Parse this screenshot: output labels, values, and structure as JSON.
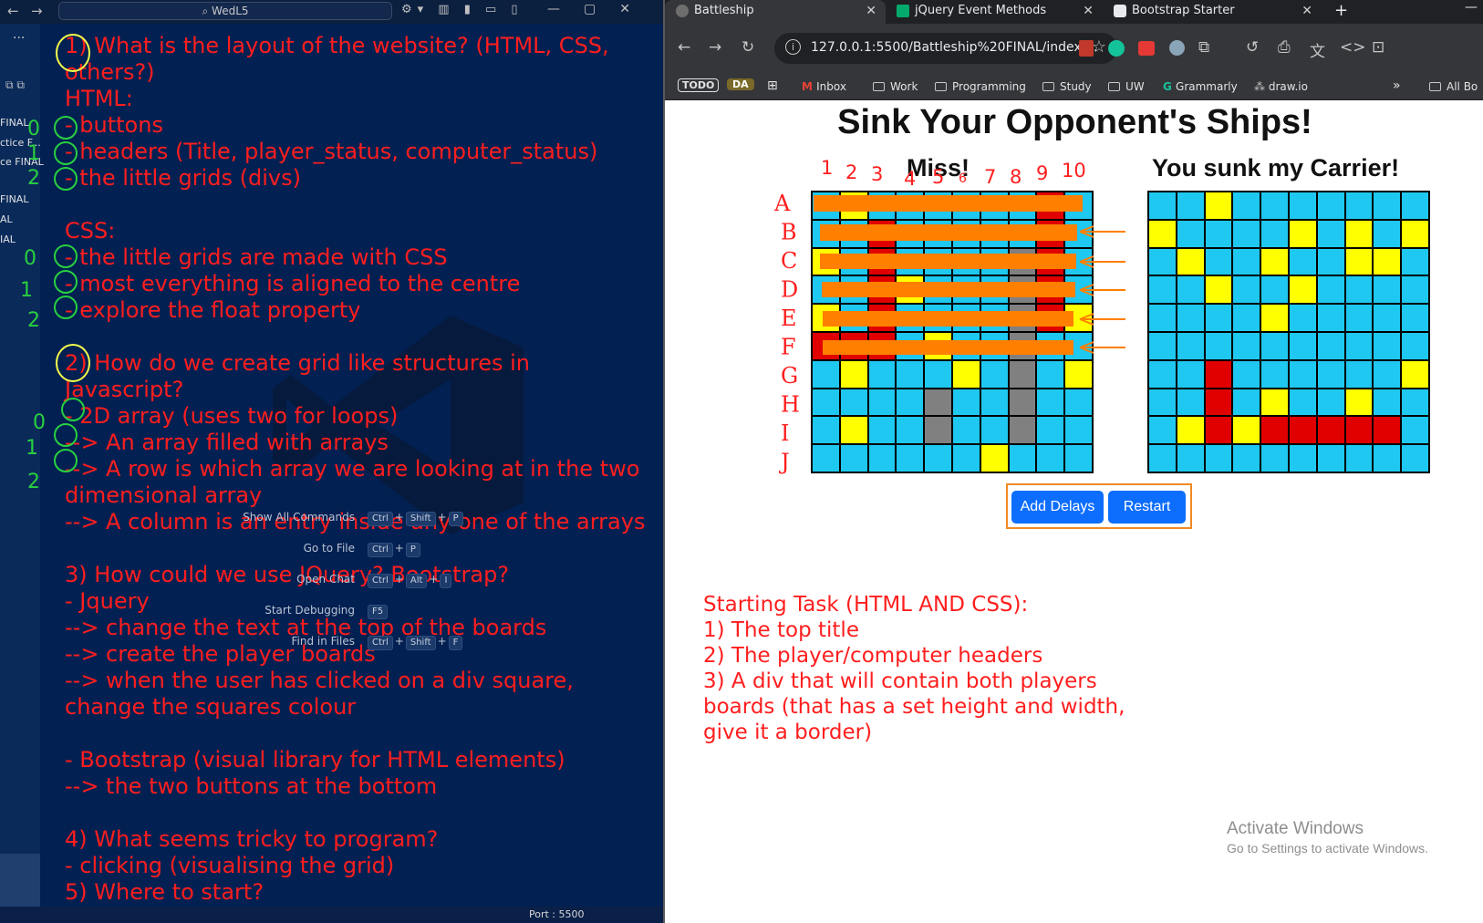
{
  "vscode": {
    "search_text": "WedL5",
    "sidebar_files": [
      "FINAL",
      "ctice F...",
      "ce FINAL",
      "FINAL",
      "AL",
      "IAL"
    ],
    "status_port": "Port : 5500",
    "notes": [
      "1) What is the layout of the website? (HTML, CSS,",
      "others?)",
      "HTML:",
      "- buttons",
      "- headers (Title, player_status, computer_status)",
      "- the little grids (divs)",
      "",
      "CSS:",
      "- the little grids are made with CSS",
      "- most everything is aligned to the centre",
      "- explore the float property",
      "",
      "2) How do we create grid like structures in",
      "Javascript?",
      "- 2D array (uses two for loops)",
      "--> An array filled with arrays",
      "--> A row is which array we are looking at in the two",
      "dimensional array",
      "--> A column is an entry inside any one of the arrays",
      "",
      "3) How could we use JQuery? Bootstrap?",
      "- Jquery",
      "--> change the text at the top of the boards",
      "--> create the player boards",
      "--> when the user has clicked on a div square,",
      "change the squares colour",
      "",
      "- Bootstrap (visual library for HTML elements)",
      "--> the two buttons at the bottom",
      "",
      "4) What seems tricky to program?",
      "- clicking (visualising the grid)",
      "5) Where to start?"
    ],
    "shortcuts": [
      {
        "label": "Show All Commands",
        "keys": [
          "Ctrl",
          "Shift",
          "P"
        ]
      },
      {
        "label": "Go to File",
        "keys": [
          "Ctrl",
          "P"
        ]
      },
      {
        "label": "Open Chat",
        "keys": [
          "Ctrl",
          "Alt",
          "I"
        ]
      },
      {
        "label": "Start Debugging",
        "keys": [
          "F5"
        ]
      },
      {
        "label": "Find in Files",
        "keys": [
          "Ctrl",
          "Shift",
          "F"
        ]
      }
    ],
    "handwritten_numbers": [
      "0",
      "1",
      "2",
      "0",
      "1",
      "2",
      "0",
      "1",
      "2"
    ]
  },
  "browser": {
    "tabs": [
      {
        "title": "Battleship",
        "active": true
      },
      {
        "title": "jQuery Event Methods",
        "active": false
      },
      {
        "title": "Bootstrap Starter",
        "active": false
      }
    ],
    "url": "127.0.0.1:5500/Battleship%20FINAL/index....",
    "bookmarks": {
      "todo": "TODO",
      "da": "DA",
      "items": [
        "Inbox",
        "Work",
        "Programming",
        "Study",
        "UW",
        "Grammarly",
        "draw.io"
      ],
      "all": "All Bo"
    },
    "page": {
      "title": "Sink Your Opponent's Ships!",
      "player_status": "Miss!",
      "computer_status": "You sunk my Carrier!",
      "buttons": {
        "add_delays": "Add Delays",
        "restart": "Restart"
      },
      "player_board": [
        "CYCCCCCCRC",
        "CCRCCCCCRC",
        "YCRCCCCGRC",
        "CCRYCCCGRC",
        "YCRCCCCGRY",
        "RRRCYCCGCC",
        "CYCCCYCGCY",
        "CCCCGCCGCC",
        "CYCCGCCGCC",
        "CCCCCCYCCC"
      ],
      "computer_board": [
        "CCYCCCCCCC",
        "YCCCCYCYCY",
        "CYCCYCCYYC",
        "CCYCCYCCCC",
        "CCCCYCCCCC",
        "CCCCCCCCCC",
        "CCRCCCCCCY",
        "CCRCYCCYCC",
        "CYRYRRRRRC",
        "CCCCCCCCCC"
      ],
      "board_colors": {
        "C": "#1ec8f0",
        "Y": "#ffff00",
        "R": "#e00000",
        "G": "#808080"
      },
      "annotation_cols": [
        "1",
        "2",
        "3",
        "4",
        "5",
        "6",
        "7",
        "8",
        "9",
        "10"
      ],
      "annotation_rows": [
        "A",
        "B",
        "C",
        "D",
        "E",
        "F",
        "G",
        "H",
        "I",
        "J"
      ],
      "task": [
        "Starting Task (HTML AND CSS):",
        "1) The top title",
        "2) The player/computer headers",
        "3) A div that will contain both players",
        "boards (that has a set height and width,",
        "give it a border)"
      ]
    },
    "activate": {
      "line1": "Activate Windows",
      "line2": "Go to Settings to activate Windows."
    }
  }
}
